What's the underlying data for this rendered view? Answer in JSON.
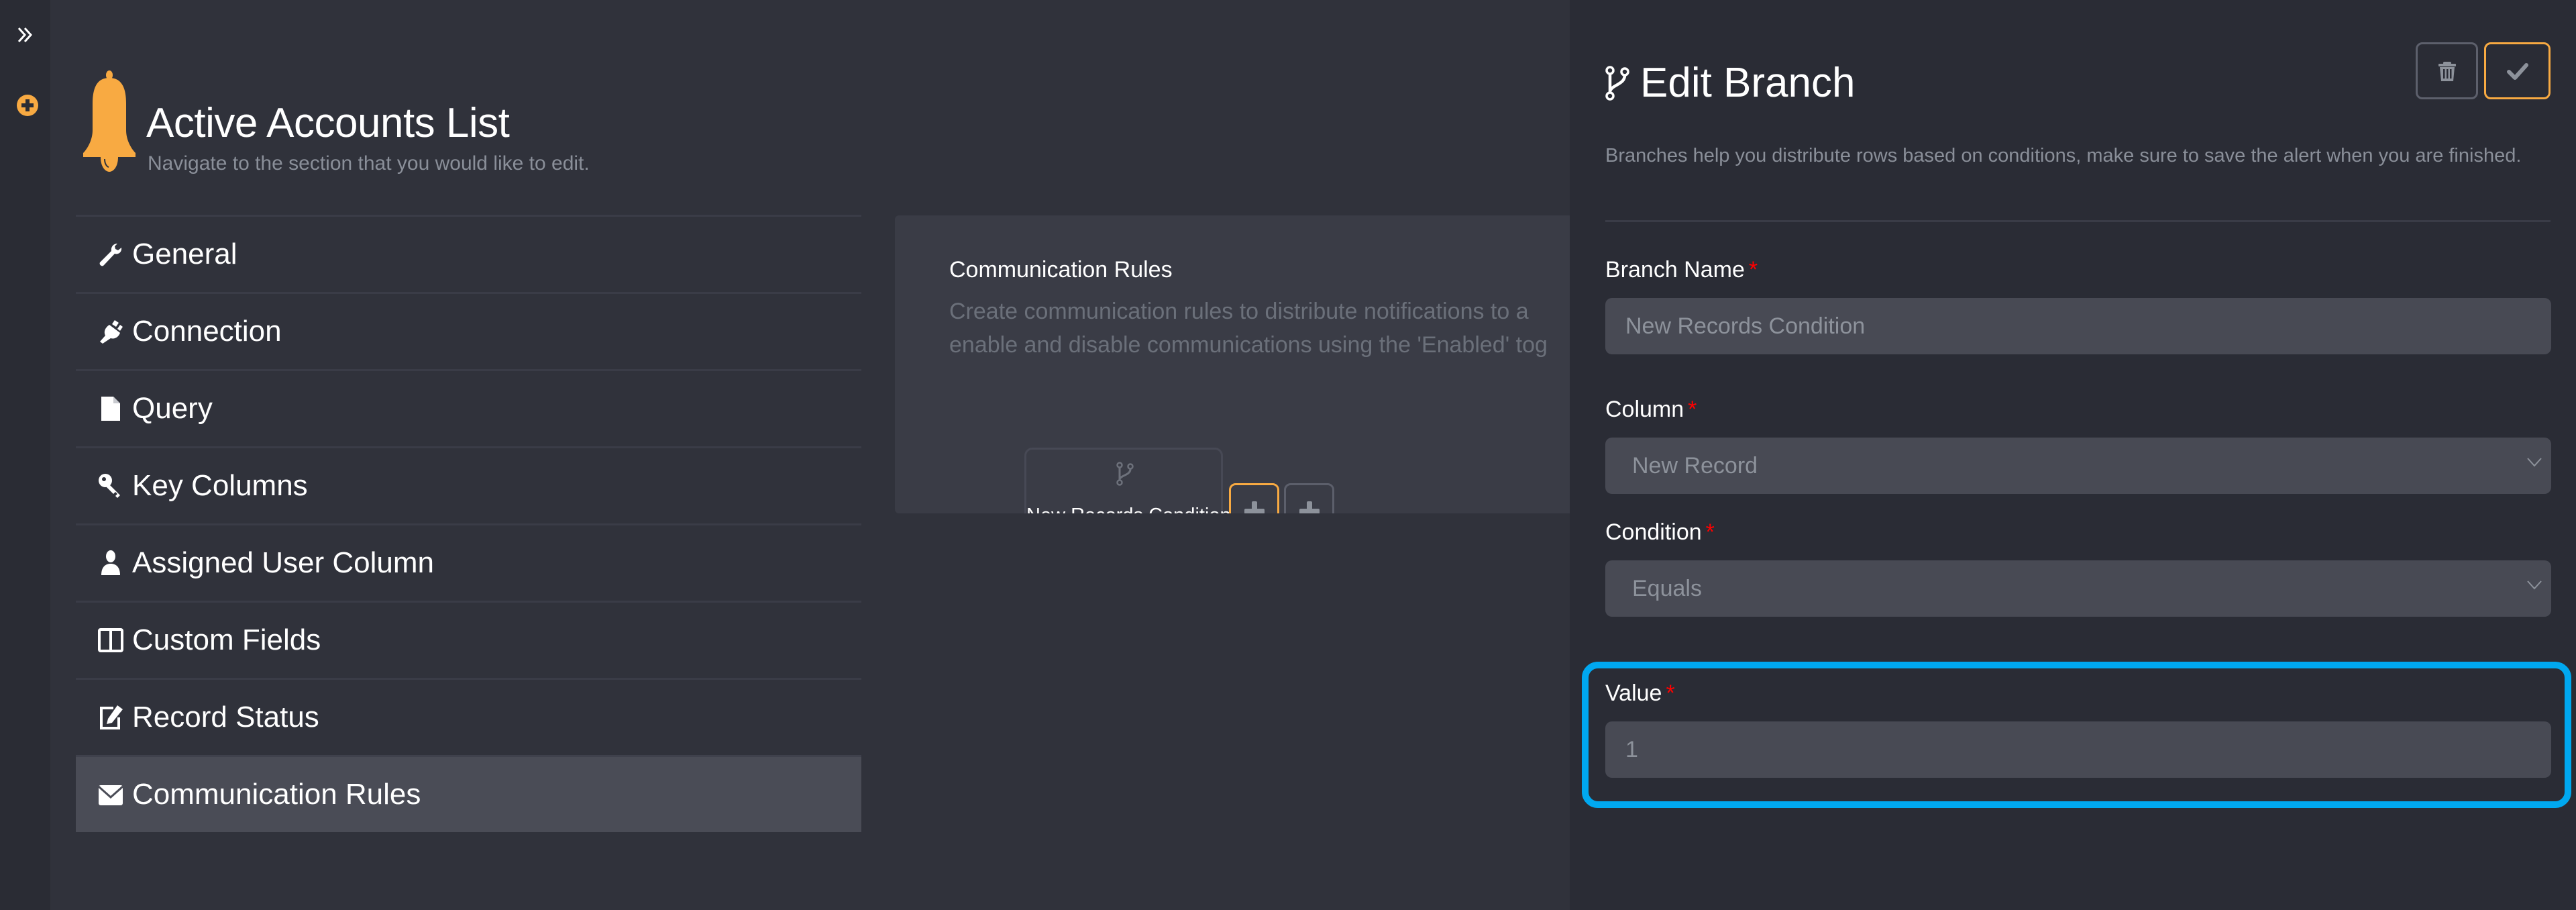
{
  "rail": {
    "expand_icon": "double-chevron-right-icon",
    "add_icon": "plus-circle-icon",
    "accent": "#f8aa42"
  },
  "header": {
    "icon": "bell-icon",
    "title": "Active Accounts List",
    "subtitle": "Navigate to the section that you would like to edit."
  },
  "nav": {
    "items": [
      {
        "label": "General",
        "icon": "wrench-icon",
        "active": false
      },
      {
        "label": "Connection",
        "icon": "plug-icon",
        "active": false
      },
      {
        "label": "Query",
        "icon": "file-icon",
        "active": false
      },
      {
        "label": "Key Columns",
        "icon": "key-icon",
        "active": false
      },
      {
        "label": "Assigned User Column",
        "icon": "user-icon",
        "active": false
      },
      {
        "label": "Custom Fields",
        "icon": "columns-icon",
        "active": false
      },
      {
        "label": "Record Status",
        "icon": "edit-icon",
        "active": false
      },
      {
        "label": "Communication Rules",
        "icon": "envelope-icon",
        "active": true
      }
    ]
  },
  "communication_rules": {
    "title": "Communication Rules",
    "description_line1": "Create communication rules to distribute notifications to a",
    "description_line2": "enable and disable communications using the 'Enabled' tog",
    "node": {
      "icon": "code-branch-icon",
      "label": "New Records Condition"
    },
    "add_buttons": [
      {
        "icon": "plus-icon",
        "highlighted": true
      },
      {
        "icon": "plus-icon",
        "highlighted": false
      }
    ]
  },
  "edit_branch": {
    "icon": "code-branch-icon",
    "title": "Edit Branch",
    "description": "Branches help you distribute rows based on conditions, make sure to save the alert when you are finished.",
    "delete_icon": "trash-icon",
    "save_icon": "check-icon",
    "required_marker": "*",
    "fields": {
      "branch_name": {
        "label": "Branch Name",
        "value": "New Records Condition"
      },
      "column": {
        "label": "Column",
        "value": "New Record"
      },
      "condition": {
        "label": "Condition",
        "value": "Equals"
      },
      "value": {
        "label": "Value",
        "value": "1"
      }
    },
    "highlight_color": "#00a8f0"
  }
}
